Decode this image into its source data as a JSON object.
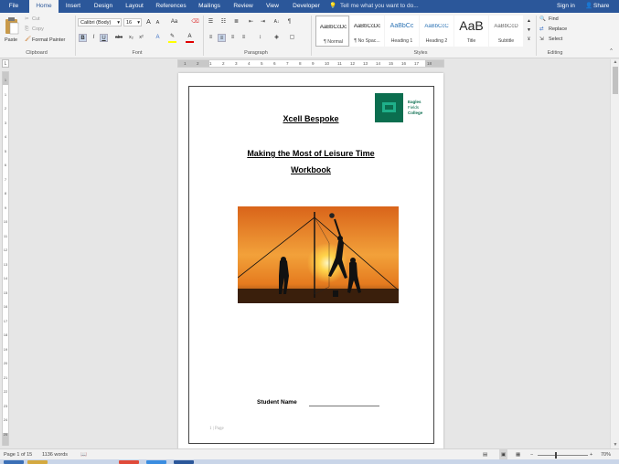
{
  "tabs": [
    {
      "label": "File",
      "name": "tab-file"
    },
    {
      "label": "Home",
      "name": "tab-home",
      "active": true
    },
    {
      "label": "Insert",
      "name": "tab-insert"
    },
    {
      "label": "Design",
      "name": "tab-design"
    },
    {
      "label": "Layout",
      "name": "tab-layout"
    },
    {
      "label": "References",
      "name": "tab-references"
    },
    {
      "label": "Mailings",
      "name": "tab-mailings"
    },
    {
      "label": "Review",
      "name": "tab-review"
    },
    {
      "label": "View",
      "name": "tab-view"
    },
    {
      "label": "Developer",
      "name": "tab-developer"
    }
  ],
  "tell_me": "Tell me what you want to do...",
  "sign_in": "Sign in",
  "share": "Share",
  "clipboard": {
    "paste": "Paste",
    "cut": "Cut",
    "copy": "Copy",
    "format_painter": "Format Painter",
    "label": "Clipboard"
  },
  "font": {
    "name": "Calibri (Body)",
    "size": "16",
    "label": "Font",
    "grow": "A",
    "shrink": "A",
    "case": "Aa",
    "bold": "B",
    "italic": "I",
    "underline": "U",
    "strike": "abc",
    "sub": "x₂",
    "sup": "x²"
  },
  "paragraph": {
    "label": "Paragraph",
    "sort": "A↓",
    "show": "¶"
  },
  "styles": {
    "label": "Styles",
    "items": [
      {
        "sample": "AaBbCcDc",
        "name": "¶ Normal"
      },
      {
        "sample": "AaBbCcDc",
        "name": "¶ No Spac..."
      },
      {
        "sample": "AaBbCc",
        "name": "Heading 1"
      },
      {
        "sample": "AaBbCcC",
        "name": "Heading 2"
      },
      {
        "sample": "AaB",
        "name": "Title"
      },
      {
        "sample": "AaBbCcD",
        "name": "Subtitle"
      }
    ]
  },
  "editing": {
    "find": "Find",
    "replace": "Replace",
    "select": "Select",
    "label": "Editing"
  },
  "ruler_corner": "L",
  "hruler_ticks": [
    "1",
    "2",
    "1",
    "2",
    "3",
    "4",
    "5",
    "6",
    "7",
    "8",
    "9",
    "10",
    "11",
    "12",
    "13",
    "14",
    "15",
    "16",
    "17",
    "18"
  ],
  "vruler_ticks": [
    "1",
    "1",
    "2",
    "3",
    "4",
    "5",
    "6",
    "7",
    "8",
    "9",
    "10",
    "11",
    "12",
    "13",
    "14",
    "15",
    "16",
    "17",
    "18",
    "19",
    "20",
    "21",
    "22",
    "23",
    "24",
    "25"
  ],
  "doc": {
    "title": "Xcell Bespoke",
    "heading1": "Making the Most of Leisure Time",
    "heading2": "Workbook",
    "logo_text": [
      "Eagles",
      "Fields",
      "College"
    ],
    "student_name": "Student Name",
    "page_footer": "1 | Page"
  },
  "status": {
    "page": "Page 1 of 15",
    "words": "1136 words",
    "zoom": "70%",
    "zoom_minus": "−",
    "zoom_plus": "+"
  },
  "colors": {
    "accent": "#2b579a",
    "logo_green": "#0b6e4f",
    "highlight": "#ffff00",
    "font_red": "#e00000"
  }
}
